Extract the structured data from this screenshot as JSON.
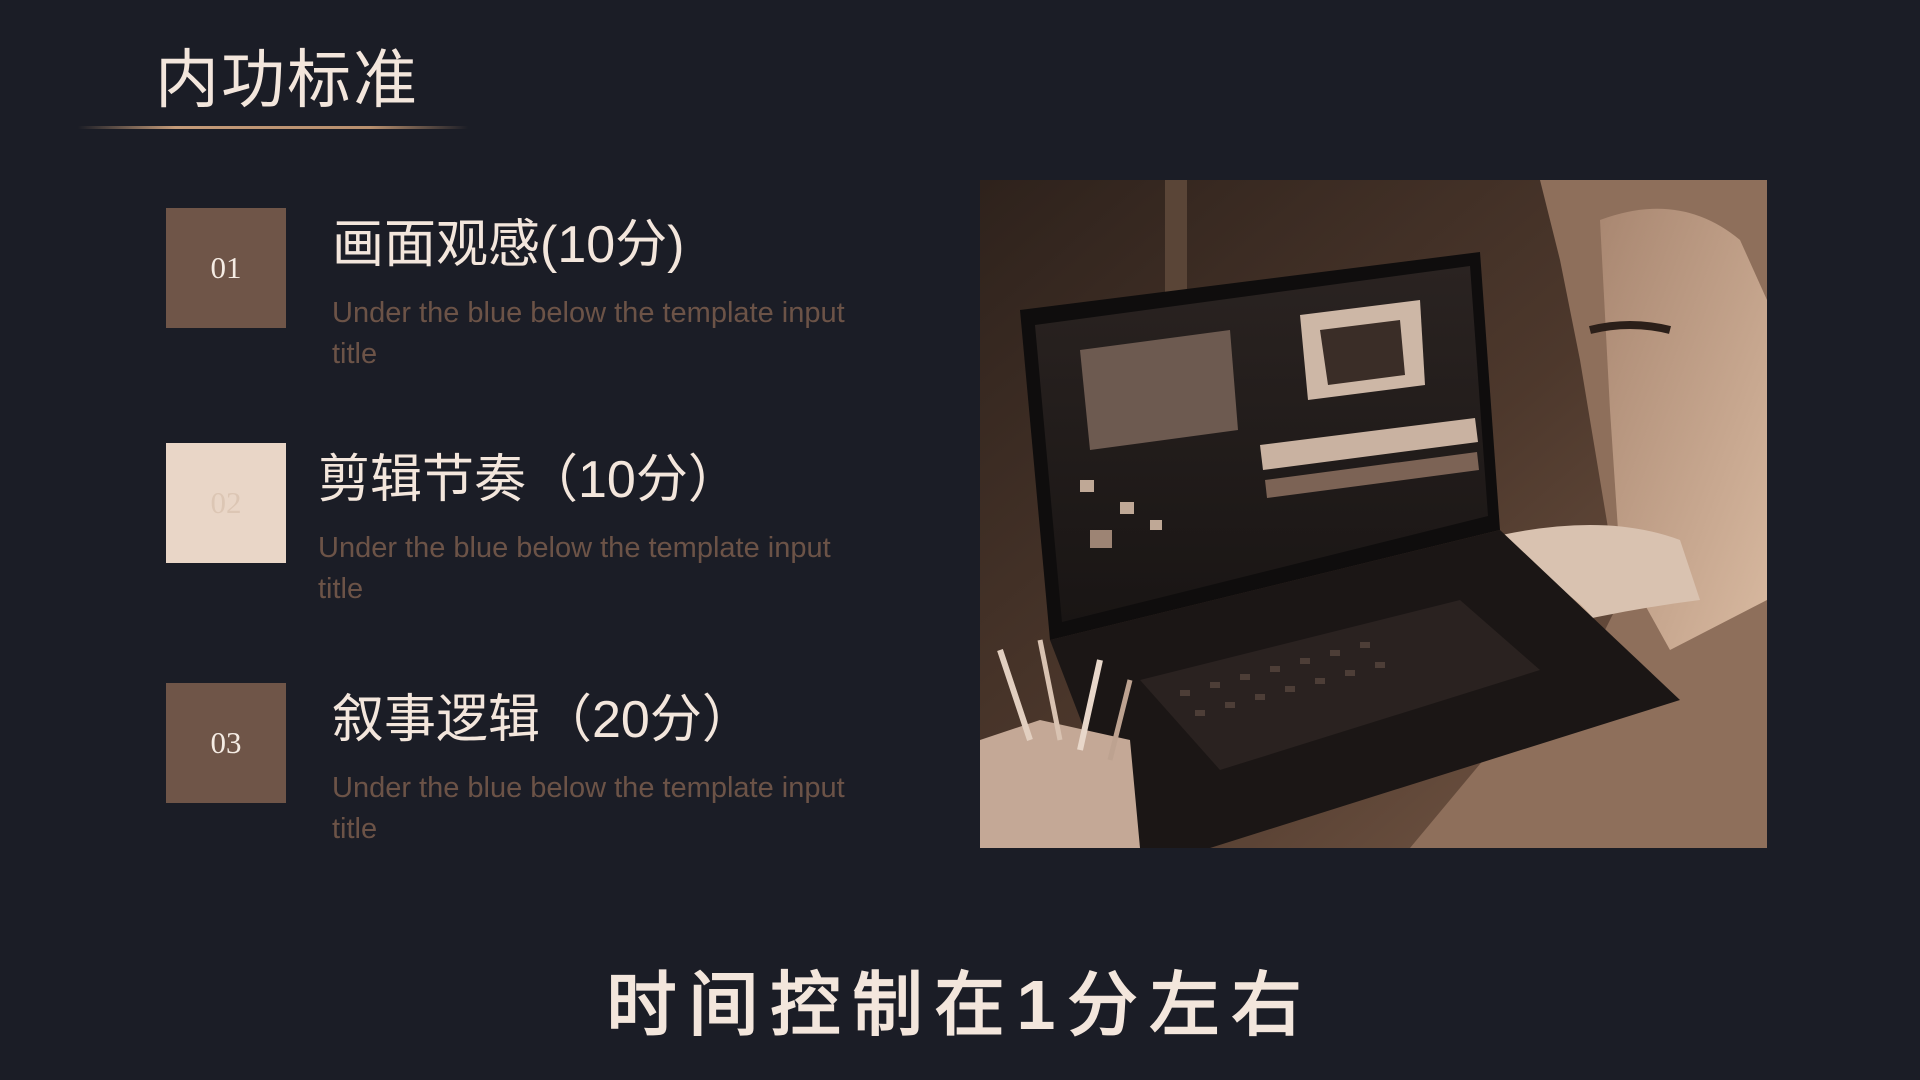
{
  "slide": {
    "title": "内功标准",
    "items": [
      {
        "number": "01",
        "title": "画面观感(10分)",
        "description": "Under the blue below the template input title"
      },
      {
        "number": "02",
        "title": "剪辑节奏（10分）",
        "description": "Under the blue below the template input title"
      },
      {
        "number": "03",
        "title": "叙事逻辑（20分）",
        "description": "Under the blue below the template input title"
      }
    ],
    "footer": "时间控制在1分左右"
  },
  "colors": {
    "background": "#1b1d26",
    "accent_brown": "#6f5548",
    "accent_light": "#e9d6c7",
    "text_light": "#f3e6dc",
    "text_muted": "#6c5347"
  }
}
